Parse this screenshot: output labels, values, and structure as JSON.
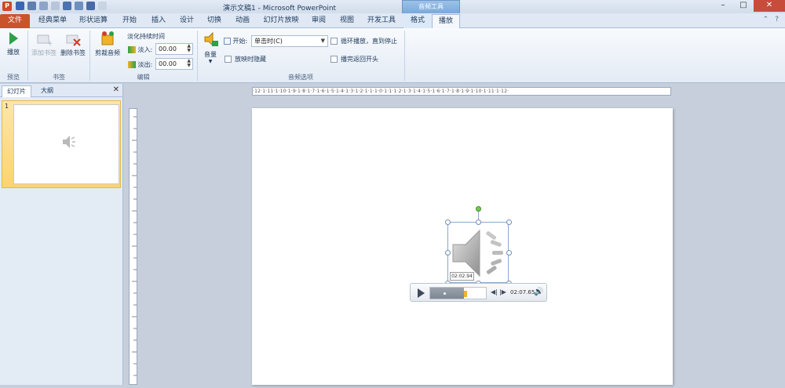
{
  "titlebar": {
    "app_letter": "P",
    "title": "演示文稿1 - Microsoft PowerPoint",
    "context_header": "音频工具",
    "minimize": "–",
    "maximize": "□",
    "close": "✕"
  },
  "tabs": [
    {
      "label": "文件"
    },
    {
      "label": "经典菜单"
    },
    {
      "label": "形状运算"
    },
    {
      "label": "开始"
    },
    {
      "label": "插入"
    },
    {
      "label": "设计"
    },
    {
      "label": "切换"
    },
    {
      "label": "动画"
    },
    {
      "label": "幻灯片放映"
    },
    {
      "label": "审阅"
    },
    {
      "label": "视图"
    },
    {
      "label": "开发工具"
    },
    {
      "label": "格式"
    },
    {
      "label": "播放"
    }
  ],
  "ribbon": {
    "preview": {
      "play_label": "播放",
      "group_label": "预览"
    },
    "bookmarks": {
      "add_label": "添加书签",
      "remove_label": "删除书签",
      "group_label": "书签"
    },
    "editing": {
      "trim_label": "剪裁音频",
      "fade_title": "淡化持续时间",
      "fade_in_label": "淡入:",
      "fade_in_value": "00.00",
      "fade_out_label": "淡出:",
      "fade_out_value": "00.00",
      "group_label": "编辑"
    },
    "audio_options": {
      "volume_label": "音量",
      "start_label": "开始:",
      "start_value": "单击时(C)",
      "hide_label": "放映时隐藏",
      "loop_label": "循环播放，直到停止",
      "rewind_label": "播完返回开头",
      "group_label": "音频选项"
    }
  },
  "pane": {
    "tab_slides": "幻灯片",
    "tab_outline": "大纲",
    "close": "✕",
    "slide_number": "1"
  },
  "ruler": {
    "horizontal": "·12·1·11·1·10·1·9·1·8·1·7·1·6·1·5·1·4·1·3·1·2·1·1·1·0·1·1·1·2·1·3·1·4·1·5·1·6·1·7·1·8·1·9·1·10·1·11·1·12·"
  },
  "player": {
    "hover_time": "02:02.94",
    "elapsed_fraction": 0.6,
    "duration": "02:07.65"
  },
  "colors": {
    "accent_file_tab": "#c9532b",
    "play_green": "#2aa14a",
    "thumb_highlight": "#fbd372"
  }
}
